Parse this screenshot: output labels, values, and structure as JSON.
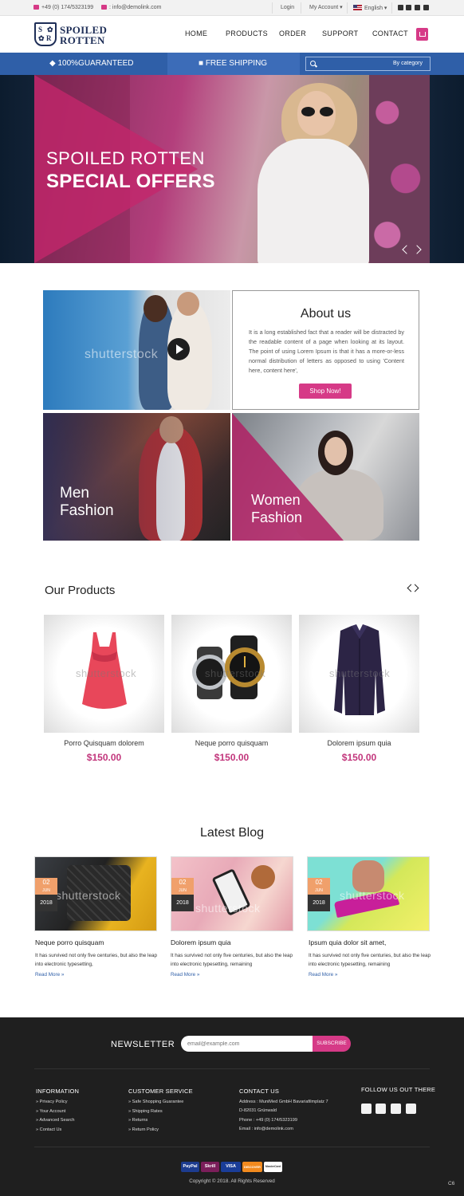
{
  "topbar": {
    "phone": "+49 (0) 174/5323199",
    "email": ": info@demolink.com",
    "login": "Login",
    "account": "My Account",
    "language": "English"
  },
  "header": {
    "logo_line1": "SPOILED",
    "logo_line2": "ROTTEN",
    "nav": [
      "HOME",
      "PRODUCTS",
      "ORDER",
      "SUPPORT",
      "CONTACT"
    ]
  },
  "bluebar": {
    "guarantee": "100%GUARANTEED",
    "shipping": "FREE SHIPPING",
    "search_category": "By category"
  },
  "hero": {
    "line1": "SPOILED ROTTEN",
    "line2": "SPECIAL OFFERS"
  },
  "about": {
    "title": "About us",
    "text": "It is a long established fact that a reader will be distracted by the readable content of a page when looking at its layout. The point of using Lorem Ipsum is that it has a more-or-less normal distribution of letters as opposed to using 'Content here, content here',",
    "button": "Shop Now!",
    "watermark": "shutterstock"
  },
  "categories": {
    "men": "Men Fashion",
    "women": "Women Fashion"
  },
  "products": {
    "title": "Our Products",
    "items": [
      {
        "name": "Porro Quisquam dolorem",
        "price": "$150.00"
      },
      {
        "name": "Neque porro quisquam",
        "price": "$150.00"
      },
      {
        "name": "Dolorem ipsum quia",
        "price": "$150.00"
      }
    ]
  },
  "blog": {
    "title": "Latest Blog",
    "posts": [
      {
        "day": "02",
        "month": "JUN",
        "year": "2018",
        "title": "Neque porro quisquam",
        "text": "It has survived not only five centuries, but also the leap into electronic typesetting,",
        "more": "Read More »"
      },
      {
        "day": "02",
        "month": "JUN",
        "year": "2018",
        "title": "Dolorem ipsum quia",
        "text": "It has survived not only five centuries, but also the leap into electronic typesetting, remaining",
        "more": "Read More »"
      },
      {
        "day": "02",
        "month": "JUN",
        "year": "2018",
        "title": "Ipsum quia dolor sit amet,",
        "text": "It has survived not only five centuries, but also the leap into electronic typesetting, remaining",
        "more": "Read More »"
      }
    ]
  },
  "newsletter": {
    "title": "NEWSLETTER",
    "placeholder": "email@example.com",
    "button": "SUBSCRIBE"
  },
  "footer": {
    "information": {
      "title": "INFORMATION",
      "links": [
        "Privacy Policy",
        "Your Account",
        "Advanced Search",
        "Contact Us"
      ]
    },
    "customer_service": {
      "title": "CUSTOMER SERVICE",
      "links": [
        "Safe Shopping Guarantee",
        "Shipping Rates",
        "Returns",
        "Return Policy"
      ]
    },
    "contact": {
      "title": "CONTACT US",
      "lines": [
        "Address : MuniMed GmbH Bavariafilmplatz 7",
        "D-82031 Grünwald",
        "Phone : +49 (0) 174/5323199",
        "Email : info@demolink.com"
      ]
    },
    "follow": "FOLLOW US OUT THERE",
    "payments": [
      "PayPal",
      "Skrill",
      "VISA",
      "DISCOVER",
      "MasterCard"
    ],
    "copyright": "Copyright © 2018. All Rights Reserved",
    "corner": "C6"
  },
  "colors": {
    "accent": "#d63a87",
    "blue": "#2f5fa8",
    "footer_bg": "#1f1f1f",
    "logo_navy": "#1e2e57"
  }
}
